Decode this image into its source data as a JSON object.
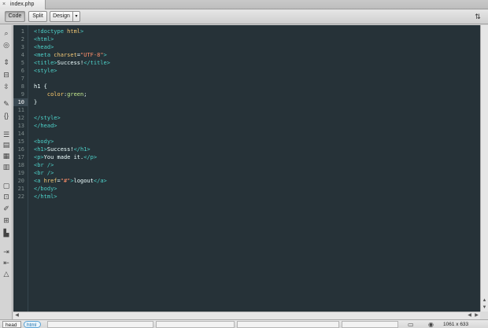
{
  "tab": {
    "filename": "index.php",
    "close_glyph": "×"
  },
  "toolbar": {
    "code_label": "Code",
    "split_label": "Split",
    "design_label": "Design",
    "design_dropdown_glyph": "▾",
    "sort_glyph": "⇅"
  },
  "editor": {
    "current_line": 10,
    "lines": [
      {
        "n": "1",
        "tokens": [
          {
            "t": "<!doctype ",
            "c": "t-tag"
          },
          {
            "t": "html",
            "c": "t-attr"
          },
          {
            "t": ">",
            "c": "t-tag"
          }
        ]
      },
      {
        "n": "2",
        "tokens": [
          {
            "t": "<html>",
            "c": "t-tag"
          }
        ]
      },
      {
        "n": "3",
        "tokens": [
          {
            "t": "<head>",
            "c": "t-tag"
          }
        ]
      },
      {
        "n": "4",
        "tokens": [
          {
            "t": "<meta ",
            "c": "t-tag"
          },
          {
            "t": "charset",
            "c": "t-attr"
          },
          {
            "t": "=",
            "c": "t-punc"
          },
          {
            "t": "\"UTF-8\"",
            "c": "t-str"
          },
          {
            "t": ">",
            "c": "t-tag"
          }
        ]
      },
      {
        "n": "5",
        "tokens": [
          {
            "t": "<title>",
            "c": "t-tag"
          },
          {
            "t": "Success!",
            "c": "t-text"
          },
          {
            "t": "</title>",
            "c": "t-tag"
          }
        ]
      },
      {
        "n": "6",
        "tokens": [
          {
            "t": "<style>",
            "c": "t-tag"
          }
        ]
      },
      {
        "n": "7",
        "tokens": []
      },
      {
        "n": "8",
        "tokens": [
          {
            "t": "h1 {",
            "c": "t-sel"
          }
        ]
      },
      {
        "n": "9",
        "tokens": [
          {
            "t": "    ",
            "c": "t-text"
          },
          {
            "t": "color",
            "c": "t-prop"
          },
          {
            "t": ":",
            "c": "t-punc"
          },
          {
            "t": "green",
            "c": "t-val"
          },
          {
            "t": ";",
            "c": "t-punc"
          }
        ]
      },
      {
        "n": "10",
        "tokens": [
          {
            "t": "}",
            "c": "t-sel"
          }
        ]
      },
      {
        "n": "11",
        "tokens": []
      },
      {
        "n": "12",
        "tokens": [
          {
            "t": "</style>",
            "c": "t-tag"
          }
        ]
      },
      {
        "n": "13",
        "tokens": [
          {
            "t": "</head>",
            "c": "t-tag"
          }
        ]
      },
      {
        "n": "14",
        "tokens": []
      },
      {
        "n": "15",
        "tokens": [
          {
            "t": "<body>",
            "c": "t-tag"
          }
        ]
      },
      {
        "n": "16",
        "tokens": [
          {
            "t": "<h1>",
            "c": "t-tag"
          },
          {
            "t": "Success!",
            "c": "t-text"
          },
          {
            "t": "</h1>",
            "c": "t-tag"
          }
        ]
      },
      {
        "n": "17",
        "tokens": [
          {
            "t": "<p>",
            "c": "t-tag"
          },
          {
            "t": "You made it.",
            "c": "t-text"
          },
          {
            "t": "</p>",
            "c": "t-tag"
          }
        ]
      },
      {
        "n": "18",
        "tokens": [
          {
            "t": "<br />",
            "c": "t-tag"
          }
        ]
      },
      {
        "n": "19",
        "tokens": [
          {
            "t": "<br />",
            "c": "t-tag"
          }
        ]
      },
      {
        "n": "20",
        "tokens": [
          {
            "t": "<a ",
            "c": "t-tag"
          },
          {
            "t": "href",
            "c": "t-attr"
          },
          {
            "t": "=",
            "c": "t-punc"
          },
          {
            "t": "\"#\"",
            "c": "t-str"
          },
          {
            "t": ">",
            "c": "t-tag"
          },
          {
            "t": "logout",
            "c": "t-text"
          },
          {
            "t": "</a>",
            "c": "t-tag"
          }
        ]
      },
      {
        "n": "21",
        "tokens": [
          {
            "t": "</body>",
            "c": "t-tag"
          }
        ]
      },
      {
        "n": "22",
        "tokens": [
          {
            "t": "</html>",
            "c": "t-tag"
          }
        ]
      }
    ]
  },
  "left_toolbar": {
    "icons": [
      {
        "name": "find-icon",
        "glyph": "⌕"
      },
      {
        "name": "target-icon",
        "glyph": "◎"
      },
      {
        "name": "collapse-full-tag-icon",
        "glyph": "⇕"
      },
      {
        "name": "collapse-selection-icon",
        "glyph": "⊟"
      },
      {
        "name": "expand-all-icon",
        "glyph": "⇳"
      },
      {
        "name": "select-parent-tag-icon",
        "glyph": "✎"
      },
      {
        "name": "balance-braces-icon",
        "glyph": "{}"
      },
      {
        "name": "line-numbers-icon",
        "glyph": "☰"
      },
      {
        "name": "highlight-invalid-icon",
        "glyph": "▤"
      },
      {
        "name": "syntax-coloring-icon",
        "glyph": "▦"
      },
      {
        "name": "word-wrap-icon",
        "glyph": "▥"
      },
      {
        "name": "apply-comment-icon",
        "glyph": "▢"
      },
      {
        "name": "remove-comment-icon",
        "glyph": "⊡"
      },
      {
        "name": "wrap-tag-icon",
        "glyph": "✐"
      },
      {
        "name": "recent-snippets-icon",
        "glyph": "⊞"
      },
      {
        "name": "move-css-icon",
        "glyph": "▙"
      },
      {
        "name": "indent-code-icon",
        "glyph": "⇥"
      },
      {
        "name": "outdent-code-icon",
        "glyph": "⇤"
      },
      {
        "name": "format-source-icon",
        "glyph": "△"
      }
    ]
  },
  "scroll": {
    "up": "▲",
    "down": "▼",
    "left": "◀",
    "right": "▶"
  },
  "statusbar": {
    "breadcrumb_head": "head",
    "breadcrumb_html": "html",
    "window_size": "1061 x 633",
    "screen_icon": "▭",
    "globe_icon": "◉"
  },
  "colors": {
    "editor_bg": "#263238",
    "tag": "#4dd0c8",
    "attr": "#f0c674",
    "string": "#ff8f6a",
    "value": "#c3e88d",
    "property": "#ffcb6b"
  }
}
